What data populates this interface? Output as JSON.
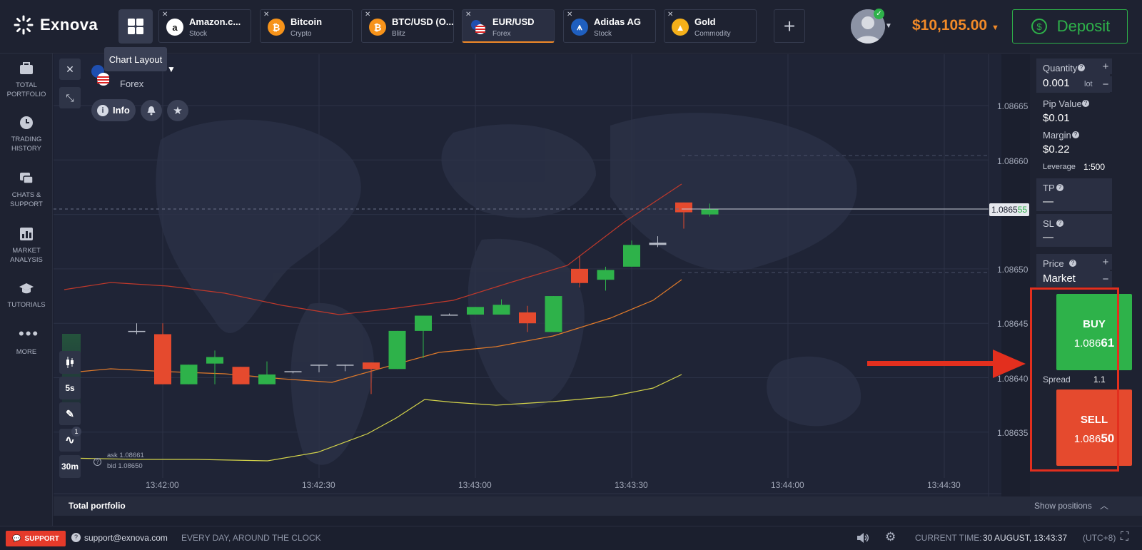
{
  "brand": {
    "name": "Exnova"
  },
  "tooltip": {
    "chart_layout": "Chart Layout"
  },
  "tabs": [
    {
      "name": "Amazon.c...",
      "type": "Stock",
      "icon": "amazon-icon"
    },
    {
      "name": "Bitcoin",
      "type": "Crypto",
      "icon": "bitcoin-icon"
    },
    {
      "name": "BTC/USD (O...",
      "type": "Blitz",
      "icon": "btc-otc-icon"
    },
    {
      "name": "EUR/USD",
      "type": "Forex",
      "icon": "eu-us-flag-icon"
    },
    {
      "name": "Adidas AG",
      "type": "Stock",
      "icon": "adidas-icon"
    },
    {
      "name": "Gold",
      "type": "Commodity",
      "icon": "gold-icon"
    }
  ],
  "account": {
    "balance": "$10,105.00",
    "deposit_label": "Deposit"
  },
  "sidebar": {
    "items": [
      {
        "label1": "TOTAL",
        "label2": "PORTFOLIO"
      },
      {
        "label1": "TRADING",
        "label2": "HISTORY"
      },
      {
        "label1": "CHATS &",
        "label2": "SUPPORT"
      },
      {
        "label1": "MARKET",
        "label2": "ANALYSIS"
      },
      {
        "label1": "TUTORIALS",
        "label2": ""
      },
      {
        "label1": "MORE",
        "label2": ""
      }
    ]
  },
  "asset_header": {
    "category": "Forex",
    "info_label": "Info"
  },
  "tools": {
    "timeframe": "5s",
    "candle_size": "30m",
    "indicator_count": "1"
  },
  "ask_bid": {
    "ask": "ask 1.08661",
    "bid": "bid 1.08650"
  },
  "price_axis": {
    "ticks": [
      "1.08665",
      "1.08660",
      "1.08650",
      "1.08645",
      "1.08640",
      "1.08635"
    ],
    "current_main": "1.0865",
    "current_tail": "55"
  },
  "time_axis": {
    "ticks": [
      "13:42:00",
      "13:42:30",
      "13:43:00",
      "13:43:30",
      "13:44:00",
      "13:44:30"
    ]
  },
  "trade_panel": {
    "quantity_label": "Quantity",
    "quantity_value": "0.001",
    "quantity_unit": "lot",
    "pip_value_label": "Pip Value",
    "pip_value": "$0.01",
    "margin_label": "Margin",
    "margin_value": "$0.22",
    "leverage_label": "Leverage",
    "leverage_value": "1:500",
    "tp_label": "TP",
    "tp_value": "—",
    "sl_label": "SL",
    "sl_value": "—",
    "price_label": "Price",
    "price_value": "Market",
    "buy_label": "BUY",
    "buy_price_main": "1.086",
    "buy_price_tail": "61",
    "spread_label": "Spread",
    "spread_value": "1.1",
    "sell_label": "SELL",
    "sell_price_main": "1.086",
    "sell_price_tail": "50"
  },
  "portfolio_bar": {
    "title": "Total portfolio",
    "show_positions": "Show positions"
  },
  "footer": {
    "support_label": "SUPPORT",
    "email": "support@exnova.com",
    "hours": "EVERY DAY, AROUND THE CLOCK",
    "time_label": "CURRENT TIME:",
    "time_value": "30 AUGUST, 13:43:37",
    "tz": "(UTC+8)"
  },
  "colors": {
    "accent": "#f28a28",
    "green": "#2eb24a",
    "red": "#e54a2e",
    "highlight": "#e32f1e"
  },
  "chart_data": {
    "type": "candlestick",
    "x_ticks": [
      "13:42:00",
      "13:42:30",
      "13:43:00",
      "13:43:30",
      "13:44:00",
      "13:44:30"
    ],
    "ylim": [
      1.08631,
      1.08668
    ],
    "candles": [
      {
        "t": "13:41:55",
        "o": 1.086443,
        "h": 1.08645,
        "l": 1.08644,
        "c": 1.086443
      },
      {
        "t": "13:42:00",
        "o": 1.08644,
        "h": 1.08645,
        "l": 1.086394,
        "c": 1.086394
      },
      {
        "t": "13:42:05",
        "o": 1.086394,
        "h": 1.086412,
        "l": 1.086394,
        "c": 1.086412
      },
      {
        "t": "13:42:10",
        "o": 1.086413,
        "h": 1.086425,
        "l": 1.086394,
        "c": 1.086419
      },
      {
        "t": "13:42:15",
        "o": 1.08641,
        "h": 1.08641,
        "l": 1.086394,
        "c": 1.086394
      },
      {
        "t": "13:42:20",
        "o": 1.086394,
        "h": 1.086415,
        "l": 1.086394,
        "c": 1.086403
      },
      {
        "t": "13:42:25",
        "o": 1.086406,
        "h": 1.086406,
        "l": 1.086404,
        "c": 1.086406
      },
      {
        "t": "13:42:30",
        "o": 1.086412,
        "h": 1.086412,
        "l": 1.086405,
        "c": 1.086412
      },
      {
        "t": "13:42:35",
        "o": 1.086412,
        "h": 1.086412,
        "l": 1.086406,
        "c": 1.086412
      },
      {
        "t": "13:42:40",
        "o": 1.086414,
        "h": 1.086414,
        "l": 1.086385,
        "c": 1.086408
      },
      {
        "t": "13:42:45",
        "o": 1.086408,
        "h": 1.086443,
        "l": 1.086408,
        "c": 1.086443
      },
      {
        "t": "13:42:50",
        "o": 1.086443,
        "h": 1.086457,
        "l": 1.086418,
        "c": 1.086457
      },
      {
        "t": "13:42:55",
        "o": 1.086457,
        "h": 1.086459,
        "l": 1.086457,
        "c": 1.086458
      },
      {
        "t": "13:43:00",
        "o": 1.086458,
        "h": 1.086465,
        "l": 1.086458,
        "c": 1.086465
      },
      {
        "t": "13:43:05",
        "o": 1.086458,
        "h": 1.086472,
        "l": 1.086458,
        "c": 1.086467
      },
      {
        "t": "13:43:10",
        "o": 1.08646,
        "h": 1.086466,
        "l": 1.086442,
        "c": 1.08645
      },
      {
        "t": "13:43:15",
        "o": 1.086442,
        "h": 1.086475,
        "l": 1.086442,
        "c": 1.086475
      },
      {
        "t": "13:43:20",
        "o": 1.0865,
        "h": 1.086512,
        "l": 1.086483,
        "c": 1.086487
      },
      {
        "t": "13:43:25",
        "o": 1.08649,
        "h": 1.086502,
        "l": 1.08648,
        "c": 1.086499
      },
      {
        "t": "13:43:30",
        "o": 1.086502,
        "h": 1.086526,
        "l": 1.086502,
        "c": 1.086522
      },
      {
        "t": "13:43:35",
        "o": 1.086522,
        "h": 1.08653,
        "l": 1.08652,
        "c": 1.086524
      },
      {
        "t": "13:43:40",
        "o": 1.086561,
        "h": 1.086561,
        "l": 1.086537,
        "c": 1.086552
      },
      {
        "t": "13:43:45",
        "o": 1.08655,
        "h": 1.08656,
        "l": 1.086548,
        "c": 1.086555
      }
    ]
  }
}
